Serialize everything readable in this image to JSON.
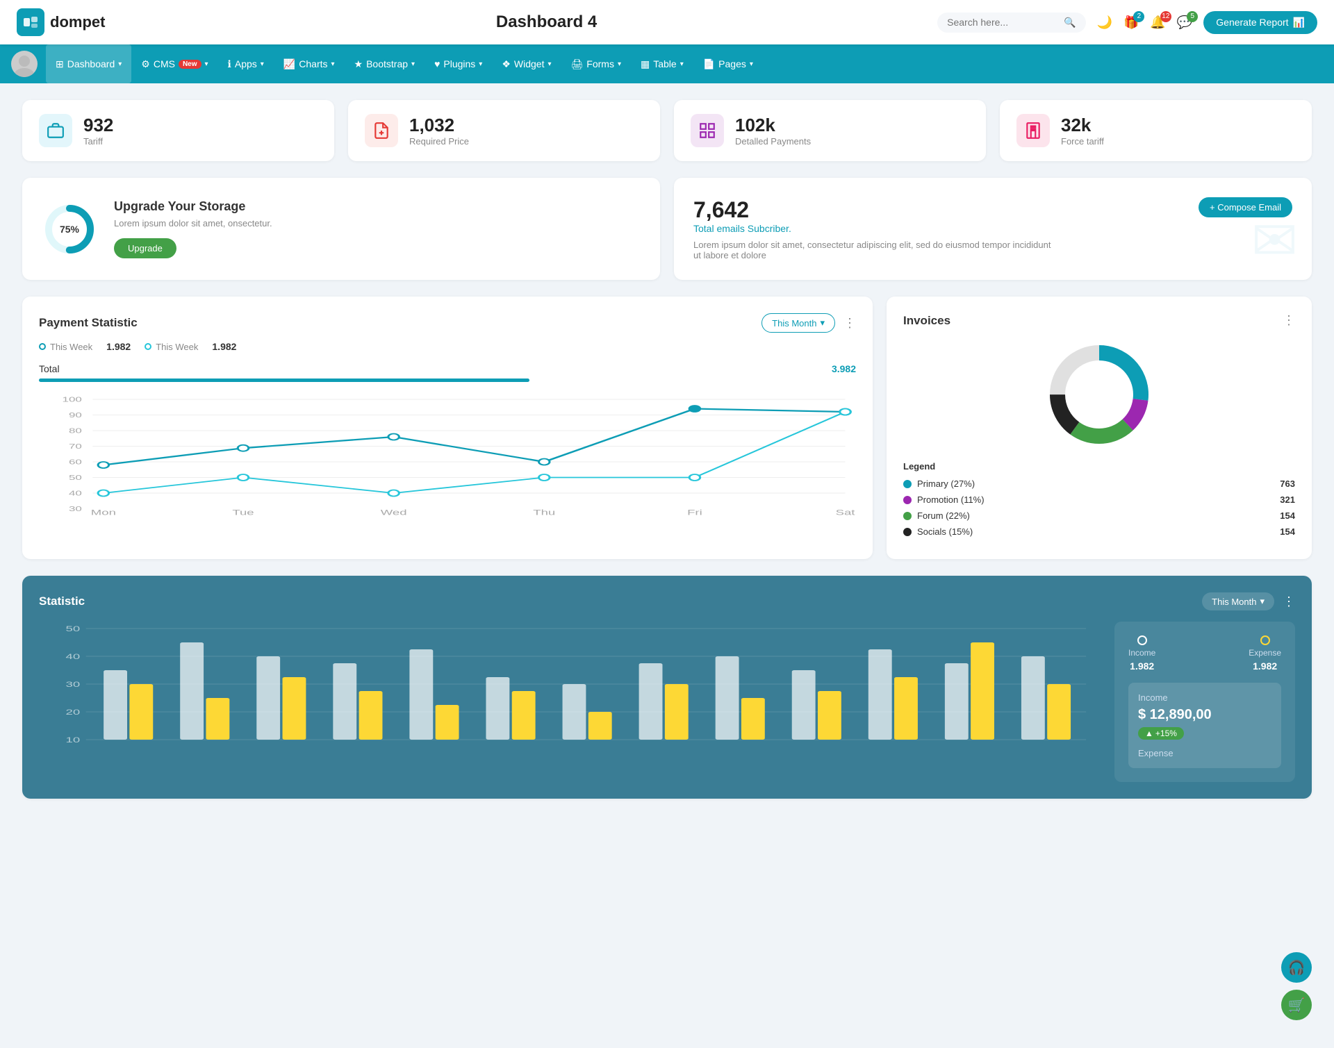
{
  "header": {
    "logo_text": "dompet",
    "title": "Dashboard 4",
    "search_placeholder": "Search here...",
    "generate_btn": "Generate Report",
    "badge_gift": "2",
    "badge_bell": "12",
    "badge_chat": "5"
  },
  "navbar": {
    "items": [
      {
        "label": "Dashboard",
        "icon": "grid-icon",
        "has_arrow": true,
        "active": true
      },
      {
        "label": "CMS",
        "icon": "gear-icon",
        "has_arrow": true,
        "badge": "New"
      },
      {
        "label": "Apps",
        "icon": "info-icon",
        "has_arrow": true
      },
      {
        "label": "Charts",
        "icon": "chart-icon",
        "has_arrow": true
      },
      {
        "label": "Bootstrap",
        "icon": "star-icon",
        "has_arrow": true
      },
      {
        "label": "Plugins",
        "icon": "heart-icon",
        "has_arrow": true
      },
      {
        "label": "Widget",
        "icon": "widget-icon",
        "has_arrow": true
      },
      {
        "label": "Forms",
        "icon": "forms-icon",
        "has_arrow": true
      },
      {
        "label": "Table",
        "icon": "table-icon",
        "has_arrow": true
      },
      {
        "label": "Pages",
        "icon": "pages-icon",
        "has_arrow": true
      }
    ]
  },
  "stat_cards": [
    {
      "value": "932",
      "label": "Tariff",
      "icon": "briefcase-icon",
      "color": "blue"
    },
    {
      "value": "1,032",
      "label": "Required Price",
      "icon": "receipt-icon",
      "color": "red"
    },
    {
      "value": "102k",
      "label": "Detalled Payments",
      "icon": "grid2-icon",
      "color": "purple"
    },
    {
      "value": "32k",
      "label": "Force tariff",
      "icon": "building-icon",
      "color": "pink"
    }
  ],
  "storage": {
    "percent": "75%",
    "title": "Upgrade Your Storage",
    "desc": "Lorem ipsum dolor sit amet, onsectetur.",
    "btn_label": "Upgrade"
  },
  "email": {
    "count": "7,642",
    "subtitle": "Total emails Subcriber.",
    "desc": "Lorem ipsum dolor sit amet, consectetur adipiscing elit, sed do eiusmod tempor incididunt ut labore et dolore",
    "compose_btn": "+ Compose Email"
  },
  "payment": {
    "title": "Payment Statistic",
    "this_month": "This Month",
    "legend1_label": "This Week",
    "legend1_value": "1.982",
    "legend2_label": "This Week",
    "legend2_value": "1.982",
    "total_label": "Total",
    "total_value": "3.982",
    "x_labels": [
      "Mon",
      "Tue",
      "Wed",
      "Thu",
      "Fri",
      "Sat"
    ],
    "y_labels": [
      "100",
      "90",
      "80",
      "70",
      "60",
      "50",
      "40",
      "30"
    ],
    "line1_points": "0,40 140,30 280,45 420,55 560,20 700,25",
    "line2_points": "0,55 140,65 280,35 420,60 560,55 700,28"
  },
  "invoices": {
    "title": "Invoices",
    "legend": [
      {
        "label": "Primary (27%)",
        "color": "#0d9db5",
        "value": "763"
      },
      {
        "label": "Promotion (11%)",
        "color": "#9c27b0",
        "value": "321"
      },
      {
        "label": "Forum (22%)",
        "color": "#43a047",
        "value": "154"
      },
      {
        "label": "Socials (15%)",
        "color": "#222",
        "value": "154"
      }
    ]
  },
  "statistic": {
    "title": "Statistic",
    "this_month": "This Month",
    "income_label": "Income",
    "income_value": "1.982",
    "expense_label": "Expense",
    "expense_value": "1.982",
    "income_amount": "$ 12,890,00",
    "income_change": "+15%",
    "expense_section_label": "Expense",
    "y_labels": [
      "50",
      "40",
      "30",
      "20",
      "10"
    ]
  },
  "float_btns": [
    {
      "icon": "headset-icon",
      "color": "teal"
    },
    {
      "icon": "cart-icon",
      "color": "green"
    }
  ]
}
